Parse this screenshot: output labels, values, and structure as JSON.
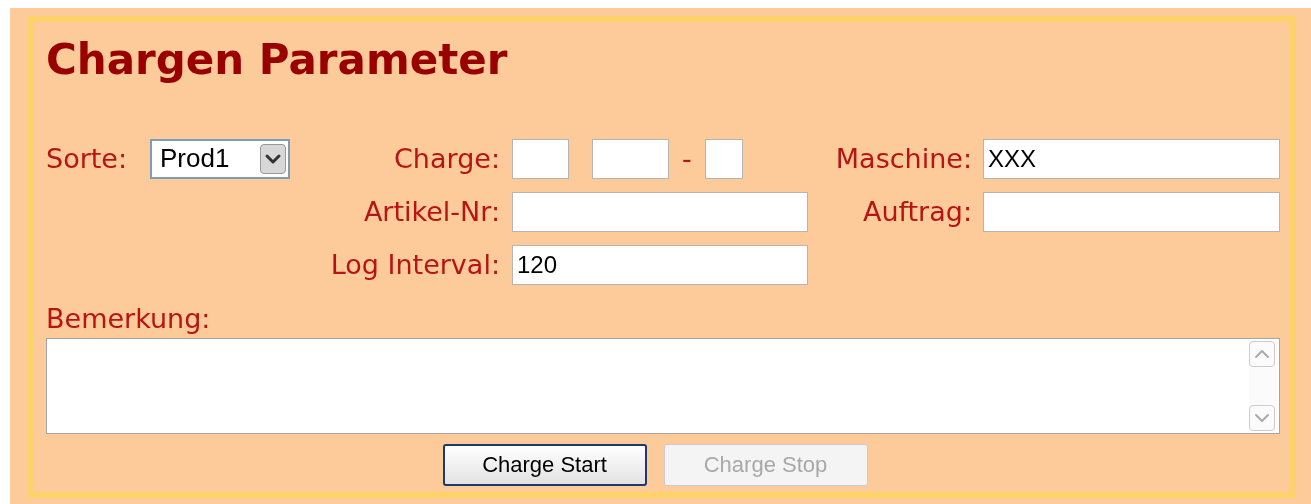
{
  "title": "Chargen Parameter",
  "sorte": {
    "label": "Sorte:",
    "value": "Prod1"
  },
  "charge": {
    "label": "Charge:",
    "separator": "-"
  },
  "maschine": {
    "label": "Maschine:",
    "value": "XXX"
  },
  "artikel_nr": {
    "label": "Artikel-Nr:"
  },
  "auftrag": {
    "label": "Auftrag:"
  },
  "log_interval": {
    "label": "Log Interval:",
    "value": "120"
  },
  "bemerkung": {
    "label": "Bemerkung:"
  },
  "buttons": [
    {
      "label": "Charge Start",
      "disabled": false
    },
    {
      "label": "Charge Stop",
      "disabled": true
    }
  ]
}
